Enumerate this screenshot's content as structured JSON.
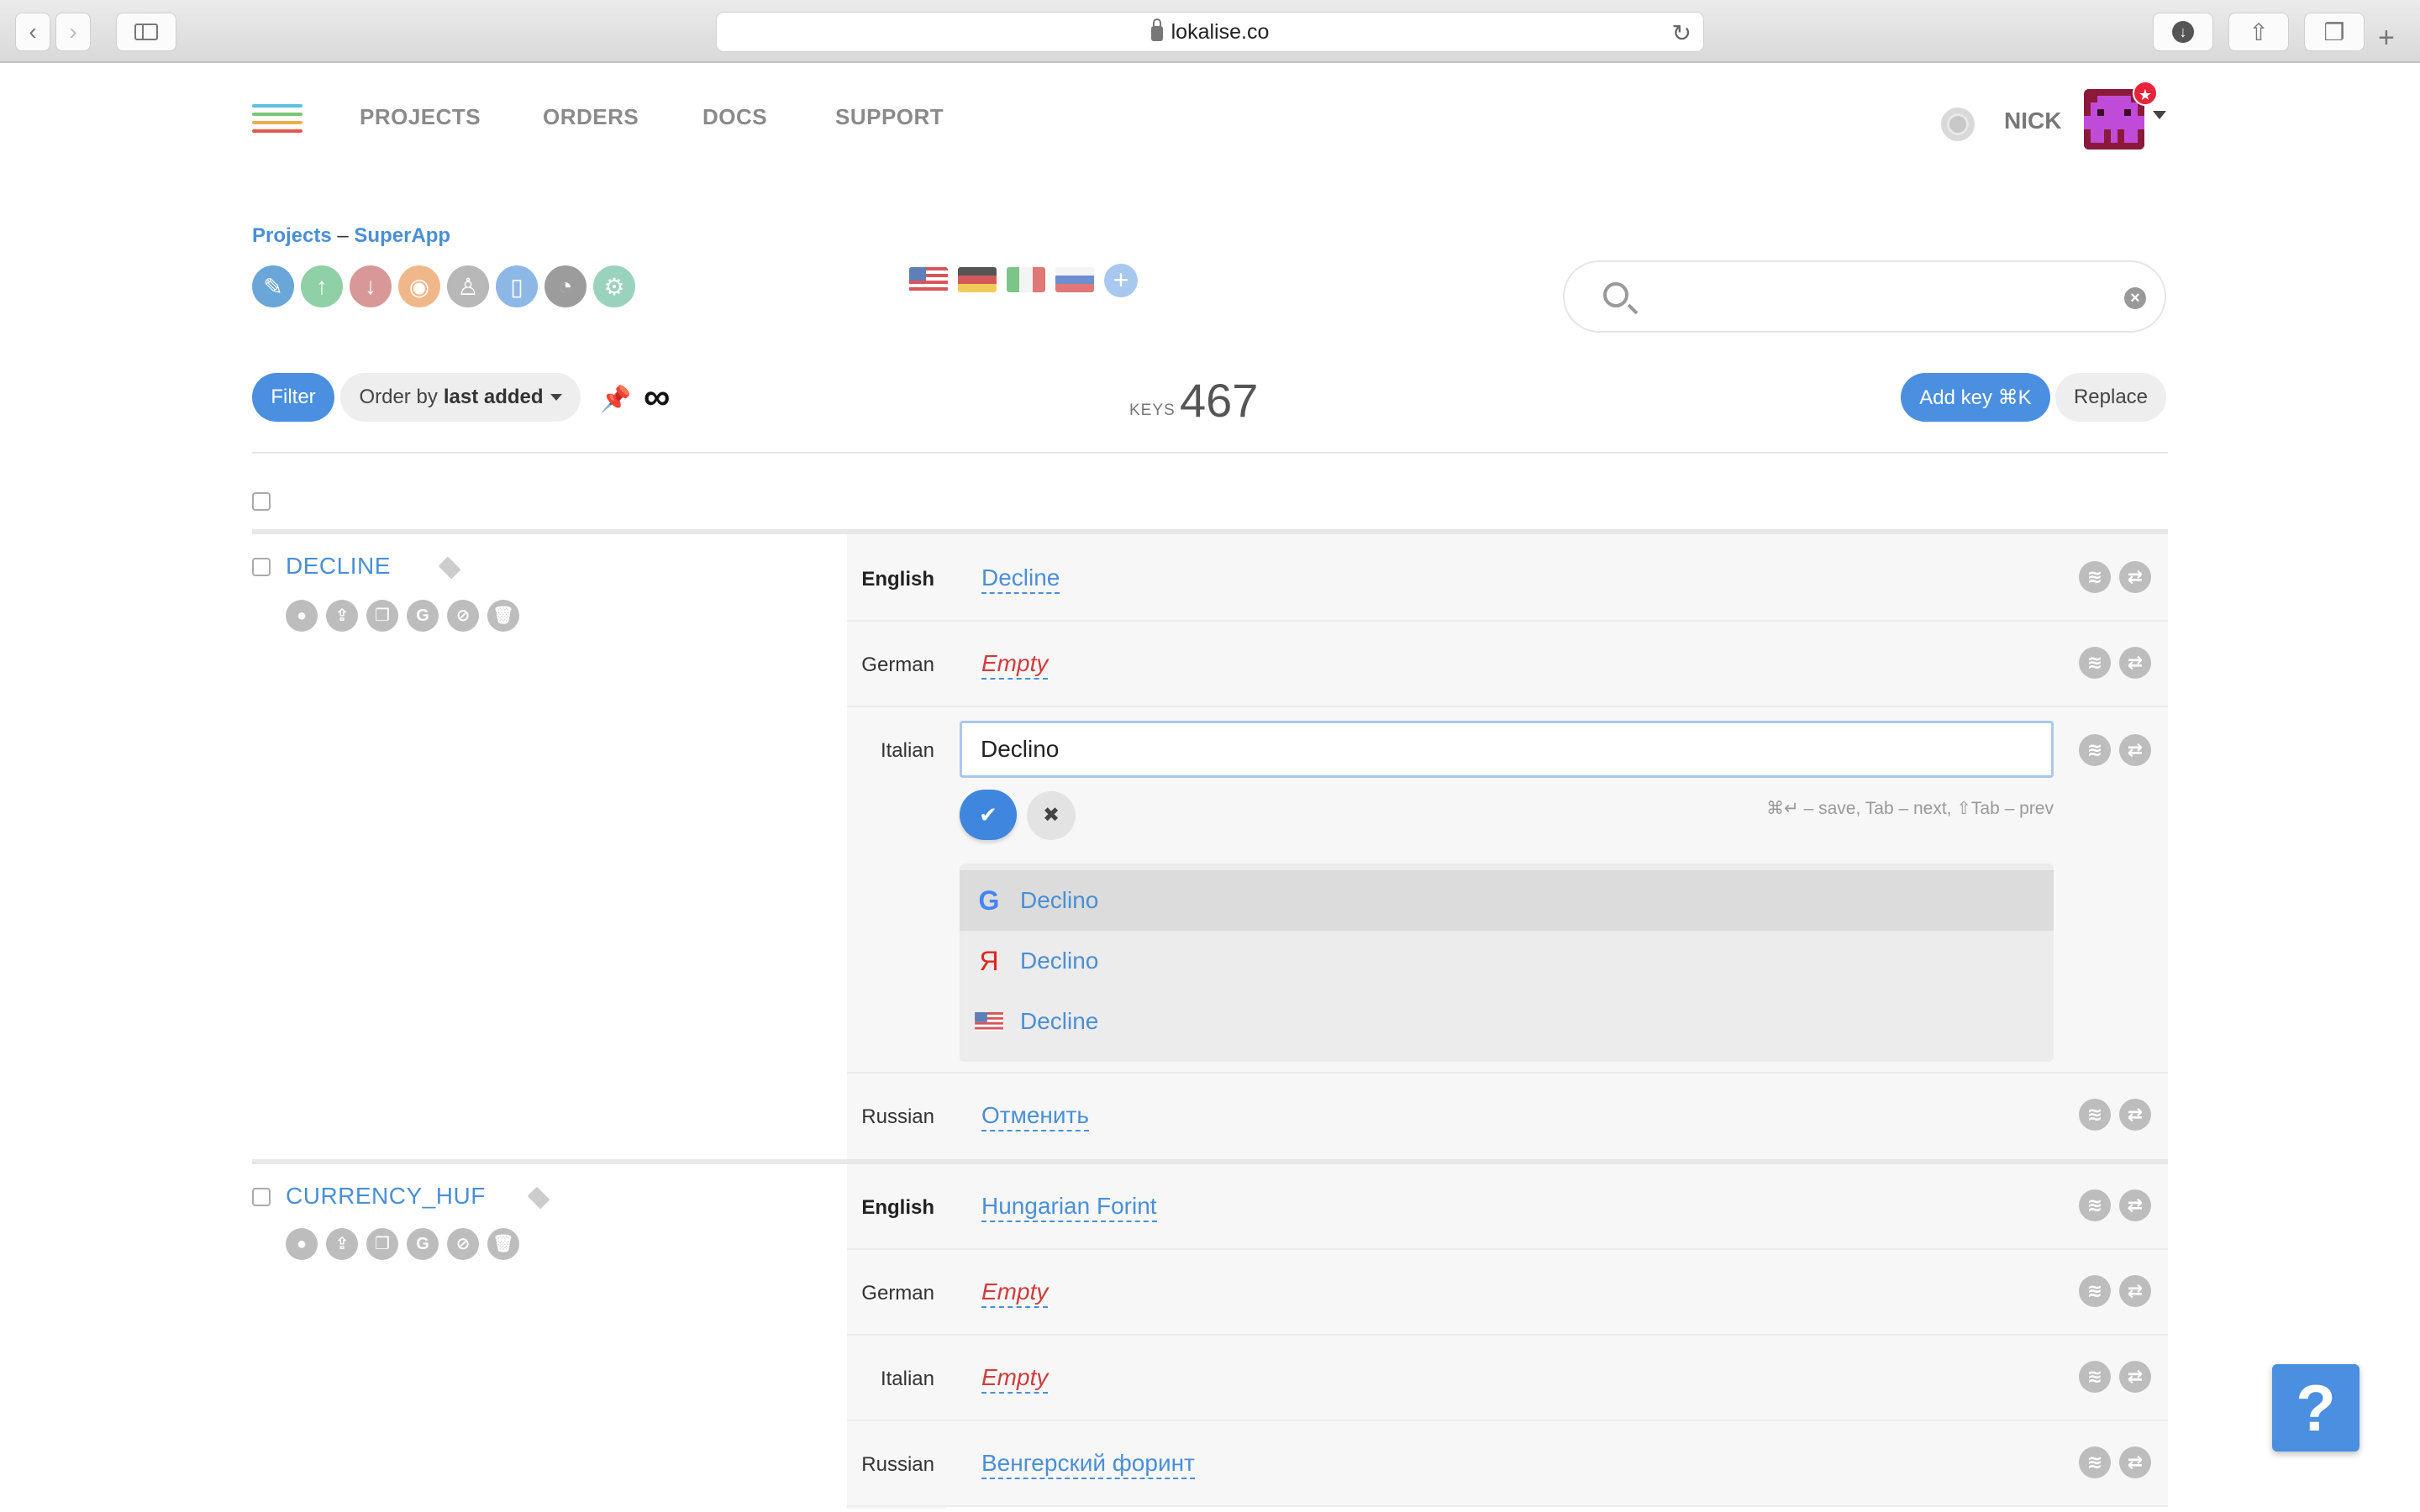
{
  "browser": {
    "url": "lokalise.co"
  },
  "nav": {
    "items": [
      "PROJECTS",
      "ORDERS",
      "DOCS",
      "SUPPORT"
    ],
    "user_name": "NICK"
  },
  "breadcrumb": {
    "root": "Projects",
    "separator": "–",
    "project": "SuperApp"
  },
  "project_tools": [
    {
      "icon": "edit-icon",
      "color": "#6aa6d8",
      "glyph": "✎"
    },
    {
      "icon": "upload-icon",
      "color": "#8fd0a6",
      "glyph": "↑"
    },
    {
      "icon": "download-icon",
      "color": "#d99898",
      "glyph": "↓"
    },
    {
      "icon": "screenshots-icon",
      "color": "#f0b88a",
      "glyph": "◉"
    },
    {
      "icon": "contributors-icon",
      "color": "#b8b8b8",
      "glyph": "♙"
    },
    {
      "icon": "glossary-icon",
      "color": "#8db8e6",
      "glyph": "▯"
    },
    {
      "icon": "statistics-icon",
      "color": "#9c9c9c",
      "glyph": "◔"
    },
    {
      "icon": "settings-icon",
      "color": "#9ad3bd",
      "glyph": "⚙"
    }
  ],
  "languages": [
    "English",
    "German",
    "Italian",
    "Russian"
  ],
  "toolbar": {
    "filter_label": "Filter",
    "order_prefix": "Order by",
    "order_value": "last added",
    "keys_label": "KEYS",
    "keys_count": "467",
    "add_key_label": "Add key ⌘K",
    "replace_label": "Replace"
  },
  "keys": [
    {
      "name": "DECLINE",
      "translations": [
        {
          "lang": "English",
          "value": "Decline",
          "empty": false
        },
        {
          "lang": "German",
          "value": "Empty",
          "empty": true
        },
        {
          "lang": "Italian",
          "value": "Declino",
          "editing": true
        },
        {
          "lang": "Russian",
          "value": "Отменить",
          "empty": false
        }
      ]
    },
    {
      "name": "CURRENCY_HUF",
      "translations": [
        {
          "lang": "English",
          "value": "Hungarian Forint",
          "empty": false
        },
        {
          "lang": "German",
          "value": "Empty",
          "empty": true
        },
        {
          "lang": "Italian",
          "value": "Empty",
          "empty": true
        },
        {
          "lang": "Russian",
          "value": "Венгерский форинт",
          "empty": false
        }
      ]
    }
  ],
  "editor": {
    "value": "Declino",
    "shortcut_hint": "⌘↵ – save, Tab – next, ⇧Tab – prev",
    "suggestions": [
      {
        "source": "google-icon",
        "text": "Declino",
        "active": true
      },
      {
        "source": "yandex-icon",
        "text": "Declino",
        "active": false
      },
      {
        "source": "us-flag-icon",
        "text": "Decline",
        "active": false
      }
    ]
  },
  "help_label": "?",
  "colors": {
    "accent": "#4a8fe0",
    "link": "#4a8fd6",
    "empty": "#d23b3b"
  }
}
